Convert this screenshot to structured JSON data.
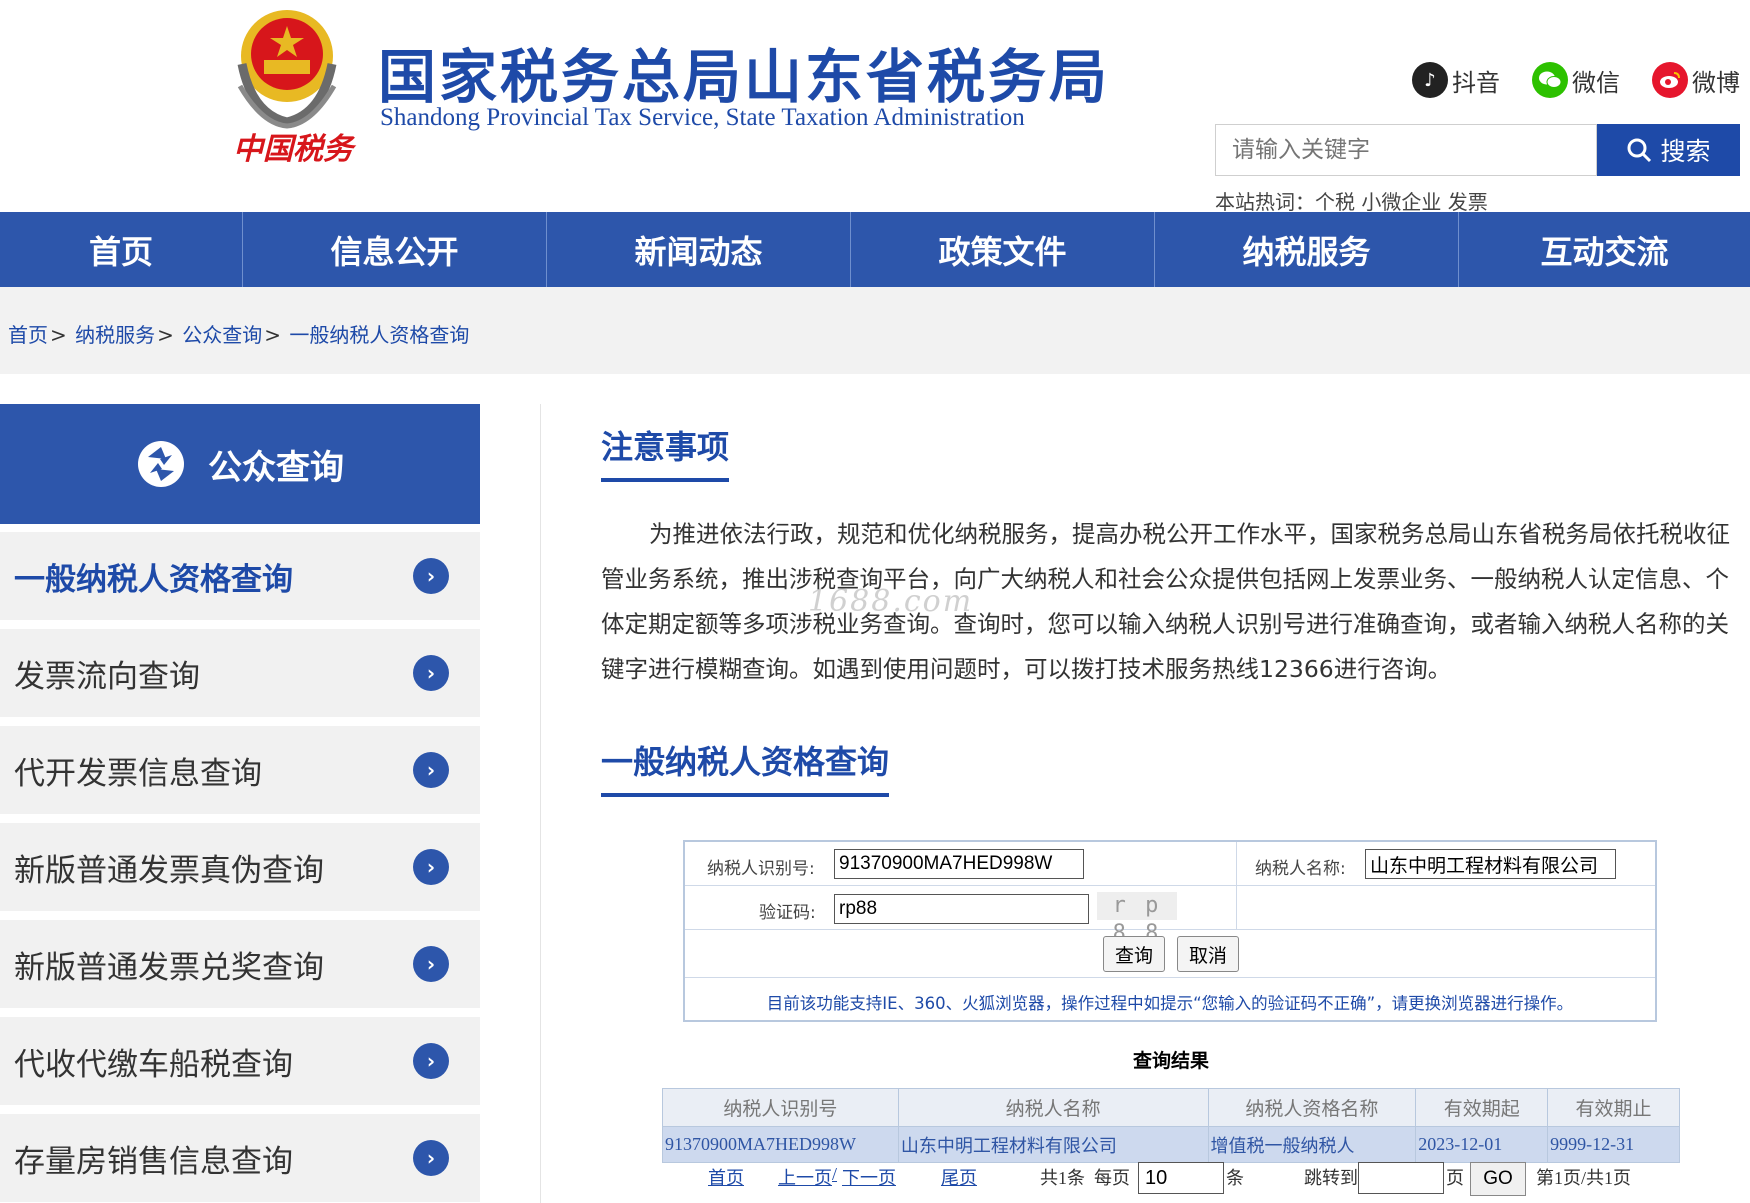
{
  "header": {
    "title": "国家税务总局山东省税务局",
    "subtitle": "Shandong Provincial Tax Service, State Taxation Administration",
    "logo_caption": "中国税务",
    "social": [
      {
        "label": "抖音",
        "icon": "douyin-icon",
        "color": "#222222"
      },
      {
        "label": "微信",
        "icon": "wechat-icon",
        "color": "#2dc100"
      },
      {
        "label": "微博",
        "icon": "weibo-icon",
        "color": "#e6162d"
      }
    ],
    "search": {
      "placeholder": "请输入关键字",
      "button_label": "搜索"
    },
    "hotwords": "本站热词：个税 小微企业 发票"
  },
  "nav": {
    "items": [
      "首页",
      "信息公开",
      "新闻动态",
      "政策文件",
      "纳税服务",
      "互动交流"
    ]
  },
  "breadcrumb": [
    "首页",
    "纳税服务",
    "公众查询",
    "一般纳税人资格查询"
  ],
  "sidebar": {
    "title": "公众查询",
    "items": [
      {
        "label": "一般纳税人资格查询",
        "active": true
      },
      {
        "label": "发票流向查询",
        "active": false
      },
      {
        "label": "代开发票信息查询",
        "active": false
      },
      {
        "label": "新版普通发票真伪查询",
        "active": false
      },
      {
        "label": "新版普通发票兑奖查询",
        "active": false
      },
      {
        "label": "代收代缴车船税查询",
        "active": false
      },
      {
        "label": "存量房销售信息查询",
        "active": false
      }
    ]
  },
  "notice": {
    "title": "注意事项",
    "body": "为推进依法行政，规范和优化纳税服务，提高办税公开工作水平，国家税务总局山东省税务局依托税收征管业务系统，推出涉税查询平台，向广大纳税人和社会公众提供包括网上发票业务、一般纳税人认定信息、个体定期定额等多项涉税业务查询。查询时，您可以输入纳税人识别号进行准确查询，或者输入纳税人名称的关键字进行模糊查询。如遇到使用问题时，可以拨打技术服务热线12366进行咨询。",
    "watermark": "1688.com"
  },
  "query": {
    "title": "一般纳税人资格查询",
    "taxpayer_id_label": "纳税人识别号:",
    "taxpayer_id_value": "91370900MA7HED998W",
    "taxpayer_name_label": "纳税人名称:",
    "taxpayer_name_value": "山东中明工程材料有限公司",
    "captcha_label": "验证码:",
    "captcha_value": "rp88",
    "captcha_image_text": "r p 8 8",
    "submit_label": "查询",
    "cancel_label": "取消",
    "tip": "目前该功能支持IE、360、火狐浏览器，操作过程中如提示“您输入的验证码不正确”，请更换浏览器进行操作。"
  },
  "results": {
    "title": "查询结果",
    "columns": [
      "纳税人识别号",
      "纳税人名称",
      "纳税人资格名称",
      "有效期起",
      "有效期止"
    ],
    "rows": [
      [
        "91370900MA7HED998W",
        "山东中明工程材料有限公司",
        "增值税一般纳税人",
        "2023-12-01",
        "9999-12-31"
      ]
    ]
  },
  "pager": {
    "first": "首页",
    "prev": "上一页",
    "slash": "/",
    "next": "下一页",
    "last": "尾页",
    "total": "共1条",
    "per_page_label": "每页",
    "per_page_value": "10",
    "per_page_unit": "条",
    "jump_label": "跳转到",
    "jump_value": "",
    "page_unit": "页",
    "go_label": "GO",
    "status": "第1页/共1页"
  },
  "colors": {
    "brand_blue": "#1e4aa8",
    "nav_blue": "#2d56ab",
    "emblem_red": "#d7161b",
    "emblem_gold": "#e8b923"
  }
}
